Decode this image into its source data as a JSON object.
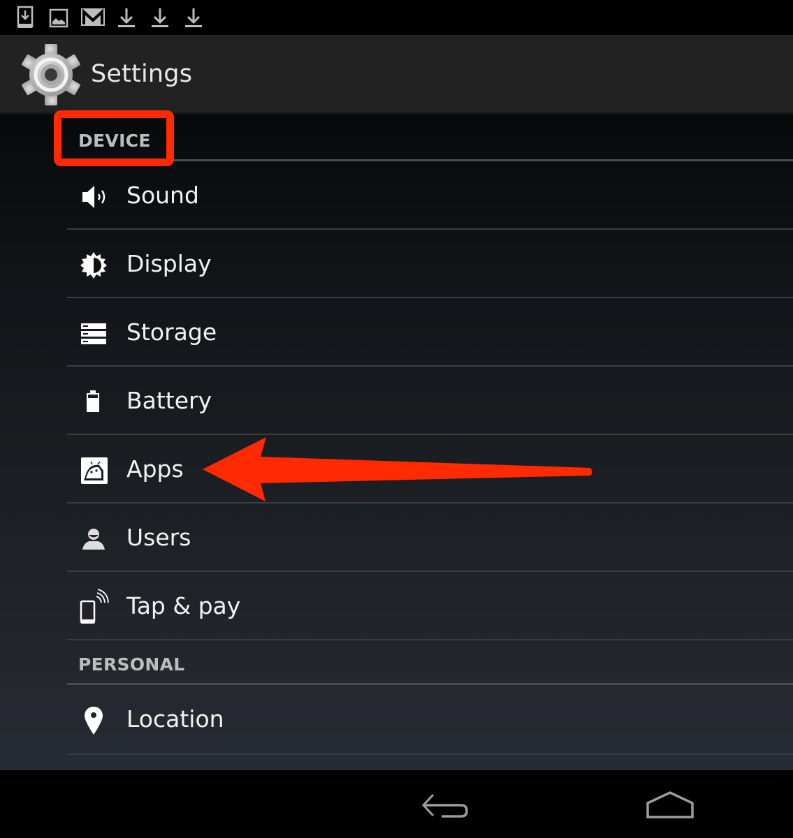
{
  "status_bar": {
    "notification_icons": [
      "download-to-device-icon",
      "image-icon",
      "gmail-icon",
      "download-icon",
      "download-icon",
      "download-icon"
    ]
  },
  "action_bar": {
    "icon": "settings-gear-icon",
    "title": "Settings"
  },
  "sections": [
    {
      "header": "DEVICE",
      "items": [
        {
          "label": "Sound",
          "icon": "speaker-icon"
        },
        {
          "label": "Display",
          "icon": "brightness-icon"
        },
        {
          "label": "Storage",
          "icon": "storage-icon"
        },
        {
          "label": "Battery",
          "icon": "battery-icon"
        },
        {
          "label": "Apps",
          "icon": "android-apps-icon"
        },
        {
          "label": "Users",
          "icon": "user-icon"
        },
        {
          "label": "Tap & pay",
          "icon": "nfc-phone-icon"
        }
      ]
    },
    {
      "header": "PERSONAL",
      "items": [
        {
          "label": "Location",
          "icon": "location-pin-icon"
        }
      ]
    }
  ],
  "annotations": {
    "highlight_target": "DEVICE",
    "arrow_target": "Apps",
    "color": "#ff2a00"
  },
  "nav_bar": {
    "buttons": [
      "back",
      "home"
    ]
  }
}
